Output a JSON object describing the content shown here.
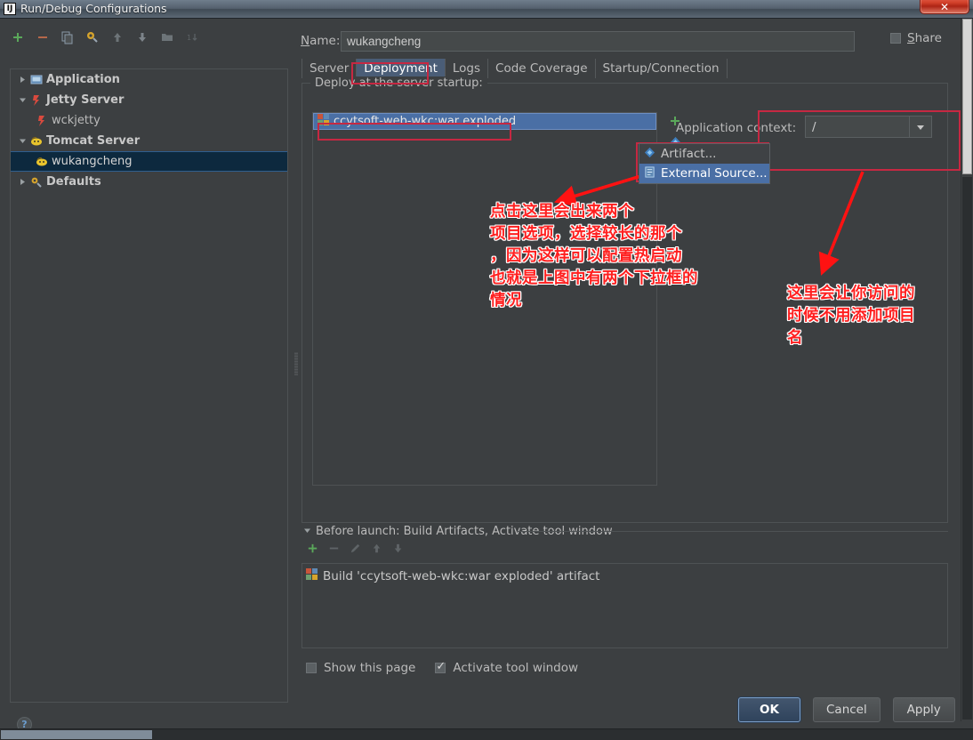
{
  "window": {
    "title": "Run/Debug Configurations",
    "logo_text": "IJ",
    "close_label": "✕"
  },
  "left_panel": {
    "toolbar": [
      {
        "name": "add-icon",
        "label": "+"
      },
      {
        "name": "remove-icon",
        "label": "−"
      },
      {
        "name": "copy-icon",
        "label": "Copy"
      },
      {
        "name": "edit-templates-icon",
        "label": "Edit Templates"
      },
      {
        "name": "move-up-icon",
        "label": "Move Up"
      },
      {
        "name": "move-down-icon",
        "label": "Move Down"
      },
      {
        "name": "folder-icon",
        "label": "Folder"
      },
      {
        "name": "sort-icon",
        "label": "Sort"
      }
    ],
    "tree": [
      {
        "label": "Application",
        "twisty": "right",
        "icon": "application-icon",
        "bold": true,
        "indent": false,
        "selected": false
      },
      {
        "label": "Jetty Server",
        "twisty": "down",
        "icon": "jetty-icon",
        "bold": true,
        "indent": false,
        "selected": false
      },
      {
        "label": "wckjetty",
        "twisty": "none",
        "icon": "jetty-icon",
        "bold": false,
        "indent": true,
        "selected": false
      },
      {
        "label": "Tomcat Server",
        "twisty": "down",
        "icon": "tomcat-icon",
        "bold": true,
        "indent": false,
        "selected": false
      },
      {
        "label": "wukangcheng",
        "twisty": "none",
        "icon": "tomcat-icon",
        "bold": false,
        "indent": true,
        "selected": true
      },
      {
        "label": "Defaults",
        "twisty": "right",
        "icon": "defaults-icon",
        "bold": true,
        "indent": false,
        "selected": false
      }
    ],
    "help_label": "?"
  },
  "right_panel": {
    "name_label": "Name:",
    "name_value": "wukangcheng",
    "name_placeholder": "",
    "share_label": "Share",
    "share_checked": false,
    "tabs": [
      {
        "label": "Server",
        "active": false
      },
      {
        "label": "Deployment",
        "active": true
      },
      {
        "label": "Logs",
        "active": false
      },
      {
        "label": "Code Coverage",
        "active": false
      },
      {
        "label": "Startup/Connection",
        "active": false
      }
    ],
    "group_title": "Deploy at the server startup:",
    "deploy_items": [
      {
        "label": "ccytsoft-web-wkc:war exploded",
        "icon": "artifact-icon",
        "selected": true
      }
    ],
    "side_buttons": [
      {
        "name": "add-deployment-button",
        "label": "+"
      },
      {
        "name": "artifact-type-button",
        "label": "◈"
      },
      {
        "name": "remove-deployment-button",
        "label": "🗑"
      }
    ],
    "popup_menu": [
      {
        "label": "Artifact...",
        "icon": "artifact-icon",
        "highlighted": false
      },
      {
        "label": "External Source...",
        "icon": "external-source-icon",
        "highlighted": true
      }
    ],
    "app_context_label": "Application context:",
    "app_context_value": "/",
    "before_launch_title": "Before launch: Build Artifacts, Activate tool window",
    "before_launch_toolbar": [
      {
        "name": "add-task-icon",
        "label": "+"
      },
      {
        "name": "remove-task-icon",
        "label": "−"
      },
      {
        "name": "edit-task-icon",
        "label": "✎"
      },
      {
        "name": "task-up-icon",
        "label": "↑"
      },
      {
        "name": "task-down-icon",
        "label": "↓"
      }
    ],
    "before_launch_items": [
      {
        "label": "Build 'ccytsoft-web-wkc:war exploded' artifact",
        "icon": "artifact-icon"
      }
    ],
    "show_page_label": "Show this page",
    "show_page_checked": false,
    "activate_tool_label": "Activate tool window",
    "activate_tool_checked": true
  },
  "buttons": {
    "ok": "OK",
    "cancel": "Cancel",
    "apply": "Apply"
  },
  "annotations": {
    "left_note": "点击这里会出来两个\n项目选项，选择较长的那个\n，因为这样可以配置热启动\n也就是上图中有两个下拉框的\n情况",
    "right_note": "这里会让你访问的\n时候不用添加项目\n名"
  },
  "colors": {
    "accent_red": "#ff1f1f",
    "box_red": "#c62842",
    "selection_blue": "#4a6fa5",
    "tree_selection": "#0d293e",
    "panel_bg": "#3c3f41",
    "field_bg": "#45494a"
  }
}
